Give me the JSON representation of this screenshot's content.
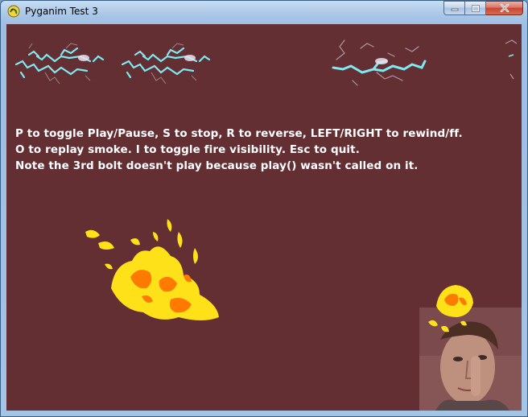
{
  "window": {
    "title": "Pyganim Test 3",
    "app_icon": "python-snake-icon",
    "buttons": [
      "minimize-icon",
      "maximize-icon",
      "close-icon"
    ]
  },
  "canvas": {
    "background": "#632f33",
    "instructions": [
      "P to toggle Play/Pause, S to stop, R to reverse, LEFT/RIGHT to rewind/ff.",
      "O to replay smoke. I to toggle fire visibility. Esc to quit.",
      "Note the 3rd bolt doesn't play because play() wasn't called on it."
    ],
    "colors": {
      "bolt": "#7fe9f2",
      "fire_outer": "#ffe11a",
      "fire_inner": "#ff7a00"
    }
  }
}
